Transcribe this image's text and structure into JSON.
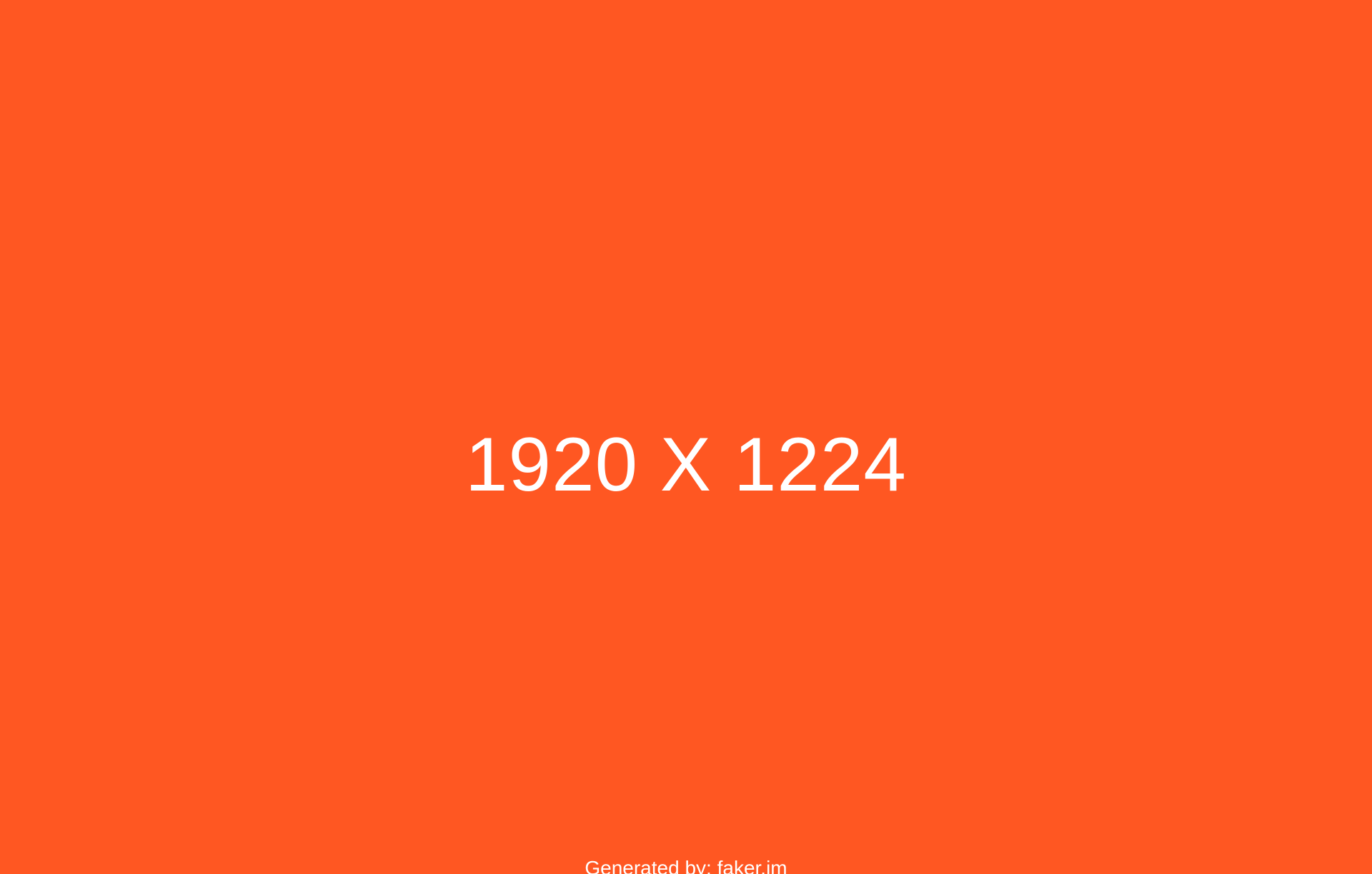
{
  "placeholder": {
    "background_color": "#ff5722",
    "text_color": "#ffffff",
    "dimensions_text": "1920 X 1224",
    "credit_text": "Generated by: faker.im"
  }
}
